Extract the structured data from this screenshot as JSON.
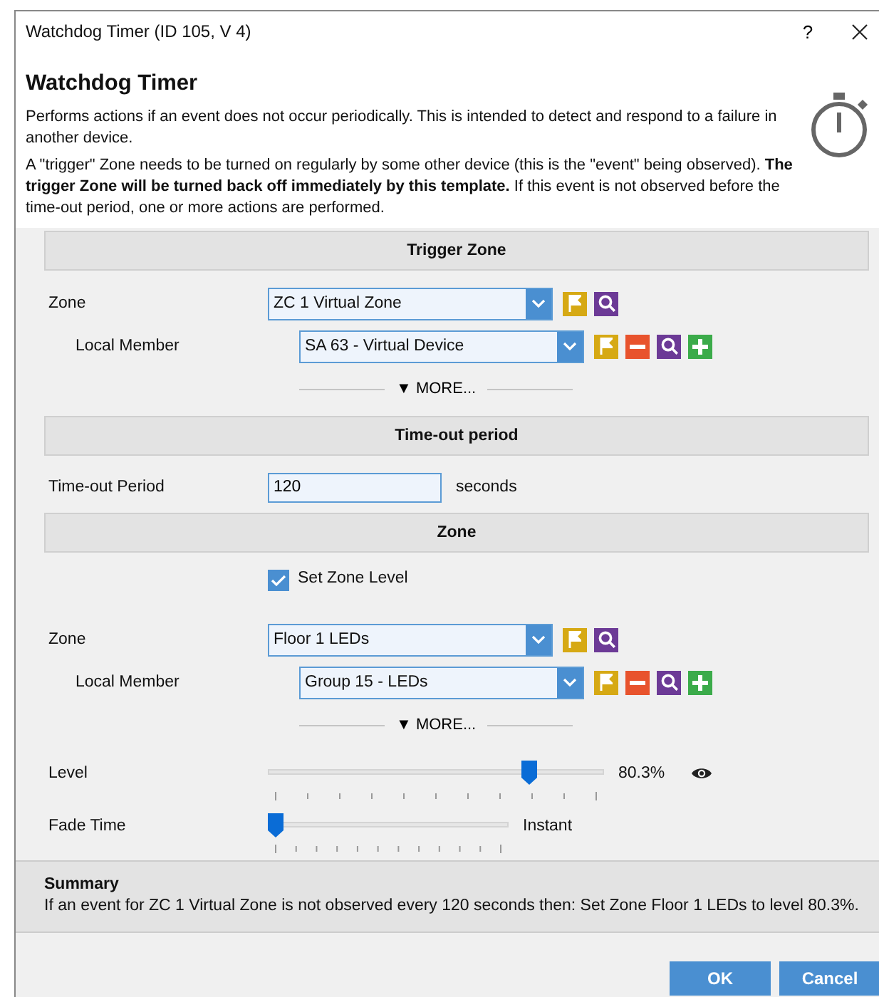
{
  "window": {
    "title": "Watchdog Timer (ID 105, V 4)",
    "help": "?"
  },
  "header": {
    "title": "Watchdog Timer",
    "paragraphs": [
      "Performs actions if an event does not occur periodically. This is intended to detect and respond to a failure in another device.",
      "A \"trigger\" Zone needs to be turned on regularly by some other device (this is the \"event\" being observed). **The trigger Zone will be turned back off immediately by this template.** If this event is not observed before the time-out period, one or more actions are performed."
    ]
  },
  "sections": [
    {
      "title": "Trigger Zone",
      "rows": [
        {
          "kind": "combo",
          "label": "Zone",
          "value": "ZC 1 Virtual Zone",
          "indented": false,
          "buttons": [
            {
              "kind": "flag"
            },
            {
              "kind": "search"
            }
          ]
        },
        {
          "kind": "combo",
          "label": "Local Member",
          "value": "SA 63 - Virtual Device",
          "indented": true,
          "buttons": [
            {
              "kind": "flag"
            },
            {
              "kind": "remove"
            },
            {
              "kind": "search"
            },
            {
              "kind": "add"
            }
          ]
        },
        {
          "kind": "more",
          "label": "▼ MORE..."
        }
      ]
    },
    {
      "title": "Time-out period",
      "rows": [
        {
          "kind": "text",
          "label": "Time-out Period",
          "value": "120",
          "unit": "seconds"
        }
      ]
    },
    {
      "title": "Zone",
      "rows": [
        {
          "kind": "checkbox",
          "label": "Set Zone Level",
          "checked": true
        },
        {
          "kind": "combo",
          "label": "Zone",
          "value": "Floor 1 LEDs",
          "indented": false,
          "buttons": [
            {
              "kind": "flag"
            },
            {
              "kind": "search"
            }
          ]
        },
        {
          "kind": "combo",
          "label": "Local Member",
          "value": "Group 15 - LEDs",
          "indented": true,
          "buttons": [
            {
              "kind": "flag"
            },
            {
              "kind": "remove"
            },
            {
              "kind": "search"
            },
            {
              "kind": "add"
            }
          ]
        },
        {
          "kind": "more",
          "label": "▼ MORE..."
        },
        {
          "kind": "dimmer",
          "label": "Level",
          "level": 0.79,
          "reading": "80.3%",
          "preview": true
        },
        {
          "kind": "duration",
          "label": "Fade Time",
          "level": 0,
          "reading": "Instant",
          "preview": false
        }
      ]
    }
  ],
  "summary": {
    "title": "Summary",
    "text": "If an event for ZC 1 Virtual Zone is not observed every 120 seconds then: Set Zone Floor 1 LEDs to level 80.3%."
  },
  "buttons": [
    "OK",
    "Cancel"
  ]
}
